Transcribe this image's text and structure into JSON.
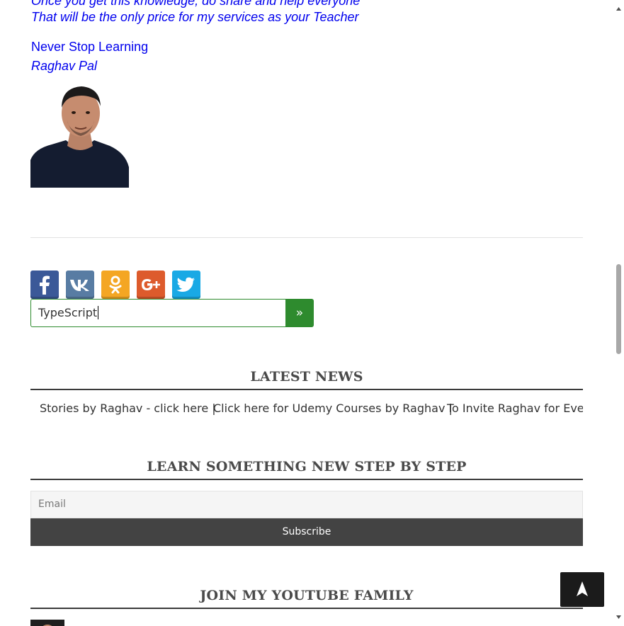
{
  "article": {
    "quote_line_1": "Once you get this knowledge, do share and help everyone",
    "quote_line_2": "That will be the only price for my services as your Teacher",
    "motto": "Never Stop Learning",
    "author": "Raghav Pal"
  },
  "share": {
    "buttons": [
      {
        "id": "facebook",
        "icon": "facebook-icon",
        "color": "#3b5998"
      },
      {
        "id": "vk",
        "icon": "vk-icon",
        "color": "#587ca3"
      },
      {
        "id": "odnoklassniki",
        "icon": "odnoklassniki-icon",
        "color": "#f4a623"
      },
      {
        "id": "google-plus",
        "icon": "google-plus-icon",
        "color": "#dd5b2c"
      },
      {
        "id": "twitter",
        "icon": "twitter-icon",
        "color": "#19a9e5"
      }
    ]
  },
  "search": {
    "value": "TypeScript",
    "button_label": "»",
    "accent_color": "#2e8b2e"
  },
  "latest_news": {
    "title": "LATEST NEWS",
    "items": [
      "Stories by Raghav - click here |",
      "Click here for Udemy Courses by Raghav |",
      "To Invite Raghav for Event"
    ]
  },
  "newsletter": {
    "title": "LEARN SOMETHING NEW STEP BY STEP",
    "email_placeholder": "Email",
    "subscribe_label": "Subscribe"
  },
  "youtube": {
    "title": "JOIN MY YOUTUBE FAMILY"
  },
  "back_to_top": {
    "icon": "up-arrow-icon",
    "label": "➤"
  }
}
